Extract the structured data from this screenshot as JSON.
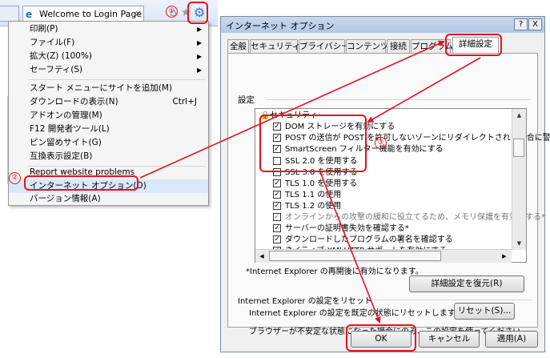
{
  "browser": {
    "tab_title": "Welcome to Login Page",
    "tab_close": "×"
  },
  "menu": {
    "items": [
      {
        "label": "印刷(P)",
        "arrow": "▶"
      },
      {
        "label": "ファイル(F)",
        "arrow": "▶"
      },
      {
        "label": "拡大(Z) (100%)",
        "arrow": "▶"
      },
      {
        "label": "セーフティ(S)",
        "arrow": "▶"
      },
      {
        "label": "スタート メニューにサイトを追加(M)"
      },
      {
        "label": "ダウンロードの表示(N)",
        "shortcut": "Ctrl+J"
      },
      {
        "label": "アドオンの管理(M)"
      },
      {
        "label": "F12 開発者ツール(L)"
      },
      {
        "label": "ピン留めサイト(G)"
      },
      {
        "label": "互換表示設定(B)"
      },
      {
        "label": "Report website problems"
      },
      {
        "label": "インターネット オプション(O)"
      },
      {
        "label": "バージョン情報(A)"
      }
    ]
  },
  "dialog": {
    "title": "インターネット オプション",
    "help_btn": "?",
    "close_btn": "X",
    "tabs": [
      "全般",
      "セキュリティ",
      "プライバシー",
      "コンテンツ",
      "接続",
      "プログラム",
      "詳細設定"
    ],
    "settings_label": "設定",
    "list": [
      {
        "label": "セキュリティ",
        "category": true
      },
      {
        "label": "DOM ストレージを有効にする",
        "checked": true
      },
      {
        "label": "POST の送信が POST を許可しないゾーンにリダイレクトされた場合に警",
        "checked": true
      },
      {
        "label": "SmartScreen フィルター機能を有効にする",
        "checked": true
      },
      {
        "label": "SSL 2.0 を使用する",
        "checked": false
      },
      {
        "label": "SSL 3.0 を使用する",
        "checked": false
      },
      {
        "label": "TLS 1.0 を使用する",
        "checked": true
      },
      {
        "label": "TLS 1.1 の使用",
        "checked": true
      },
      {
        "label": "TLS 1.2 の使用",
        "checked": true
      },
      {
        "label": "オンラインからの攻撃の緩和に役立てるため、メモリ保護を有効にする*",
        "checked": true
      },
      {
        "label": "サーバーの証明書失効を確認する*",
        "checked": true
      },
      {
        "label": "ダウンロードしたプログラムの署名を確認する",
        "checked": true
      },
      {
        "label": "ネイティブ XMLHTTP サポートを有効にする",
        "checked": true
      }
    ],
    "restart_note": "*Internet Explorer の再開後に有効になります。",
    "restore_btn": "詳細設定を復元(R)",
    "reset_group": "Internet Explorer の設定をリセット",
    "reset_desc": "Internet Explorer の設定を既定の状態にリセットします。",
    "reset_btn": "リセット(S)...",
    "reset_note": "ブラウザーが不安定な状態になった場合にのみ、この設定を使ってください。",
    "ok_btn": "OK",
    "cancel_btn": "キャンセル",
    "apply_btn": "適用(A)"
  },
  "annotations": {
    "step1": "①",
    "step2": "②",
    "step3": "③",
    "color": "#e8111c"
  },
  "icons": {
    "gear": "gear-icon",
    "lock": "lock-icon",
    "tab": "ie-logo-icon"
  }
}
